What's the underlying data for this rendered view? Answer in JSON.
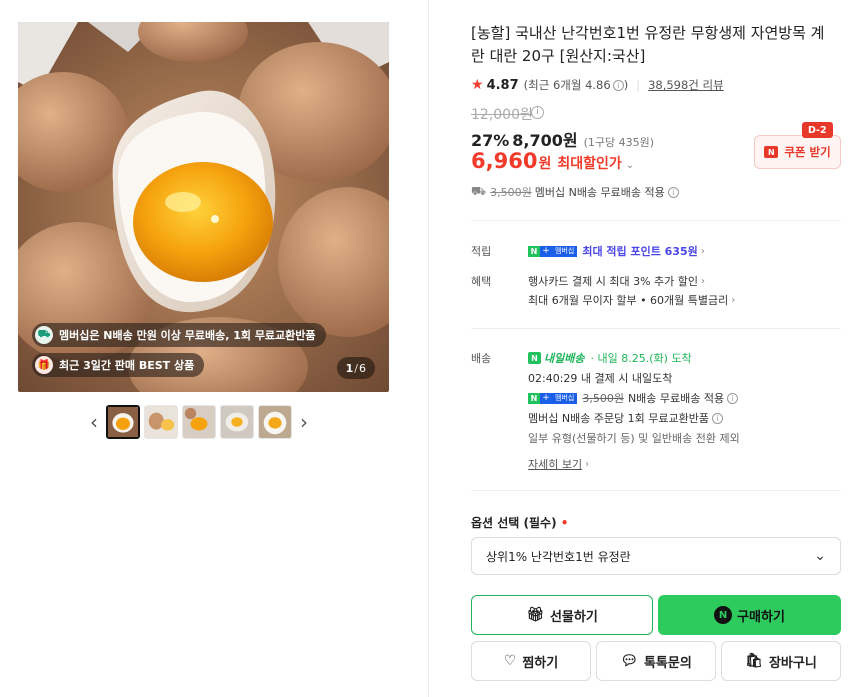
{
  "gallery": {
    "badges": [
      {
        "icon": "delivery-truck-icon",
        "text": "멤버십은 N배송 만원 이상 무료배송, 1회 무료교환반품"
      },
      {
        "icon": "gift-icon",
        "text": "최근 3일간 판매 BEST 상품"
      }
    ],
    "counter_current": "1",
    "counter_sep": "/",
    "counter_total": "6",
    "thumbnails": 5,
    "prev_icon": "chevron-left-icon",
    "next_icon": "chevron-right-icon"
  },
  "product": {
    "title": "[농할] 국내산 난각번호1번 유정란 무항생제 자연방목 계란 대란 20구 [원산지:국산]",
    "rating": "4.87",
    "rating_recent": "(최근 6개월 4.86",
    "rating_recent_close": ")",
    "reviews": "38,598건 리뷰",
    "original_price": "12,000원",
    "discount_pct": "27%",
    "sale_price": "8,700원",
    "unit_price": "(1구당 435원)",
    "max_price": "6,960",
    "max_won": "원",
    "max_label": "최대할인가",
    "coupon_label": "쿠폰 받기",
    "coupon_dday": "D-2",
    "shipping_strike": "3,500원",
    "shipping_text": "멤버십 N배송 무료배송 적용"
  },
  "benefits": {
    "points_label": "적립",
    "points_text": "최대 적립 포인트 635원",
    "perks_label": "혜택",
    "perk1": "행사카드 결제 시 최대 3% 추가 할인",
    "perk2": "최대 6개월 무이자 할부 • 60개월 특별금리"
  },
  "delivery": {
    "label": "배송",
    "tomorrow": "내일배송",
    "arrival": "· 내일 8.25.(화) 도착",
    "cutoff": "02:40:29 내 결제 시 내일도착",
    "ship_strike": "3,500원",
    "ship_free": "N배송 무료배송 적용",
    "returns": "멤버십 N배송 주문당 1회 무료교환반품",
    "exception": "일부 유형(선물하기 등) 및 일반배송 전환 제외",
    "more": "자세히 보기"
  },
  "options": {
    "label": "옵션 선택 (필수)",
    "required_mark": "•",
    "selected": "상위1% 난각번호1번 유정란"
  },
  "actions": {
    "gift": "선물하기",
    "buy": "구매하기",
    "like": "찜하기",
    "talk": "톡톡문의",
    "cart": "장바구니"
  },
  "colors": {
    "accent_red": "#f03a2a",
    "naver_green": "#2dcb5e",
    "benefit_blue": "#4a46e8"
  }
}
